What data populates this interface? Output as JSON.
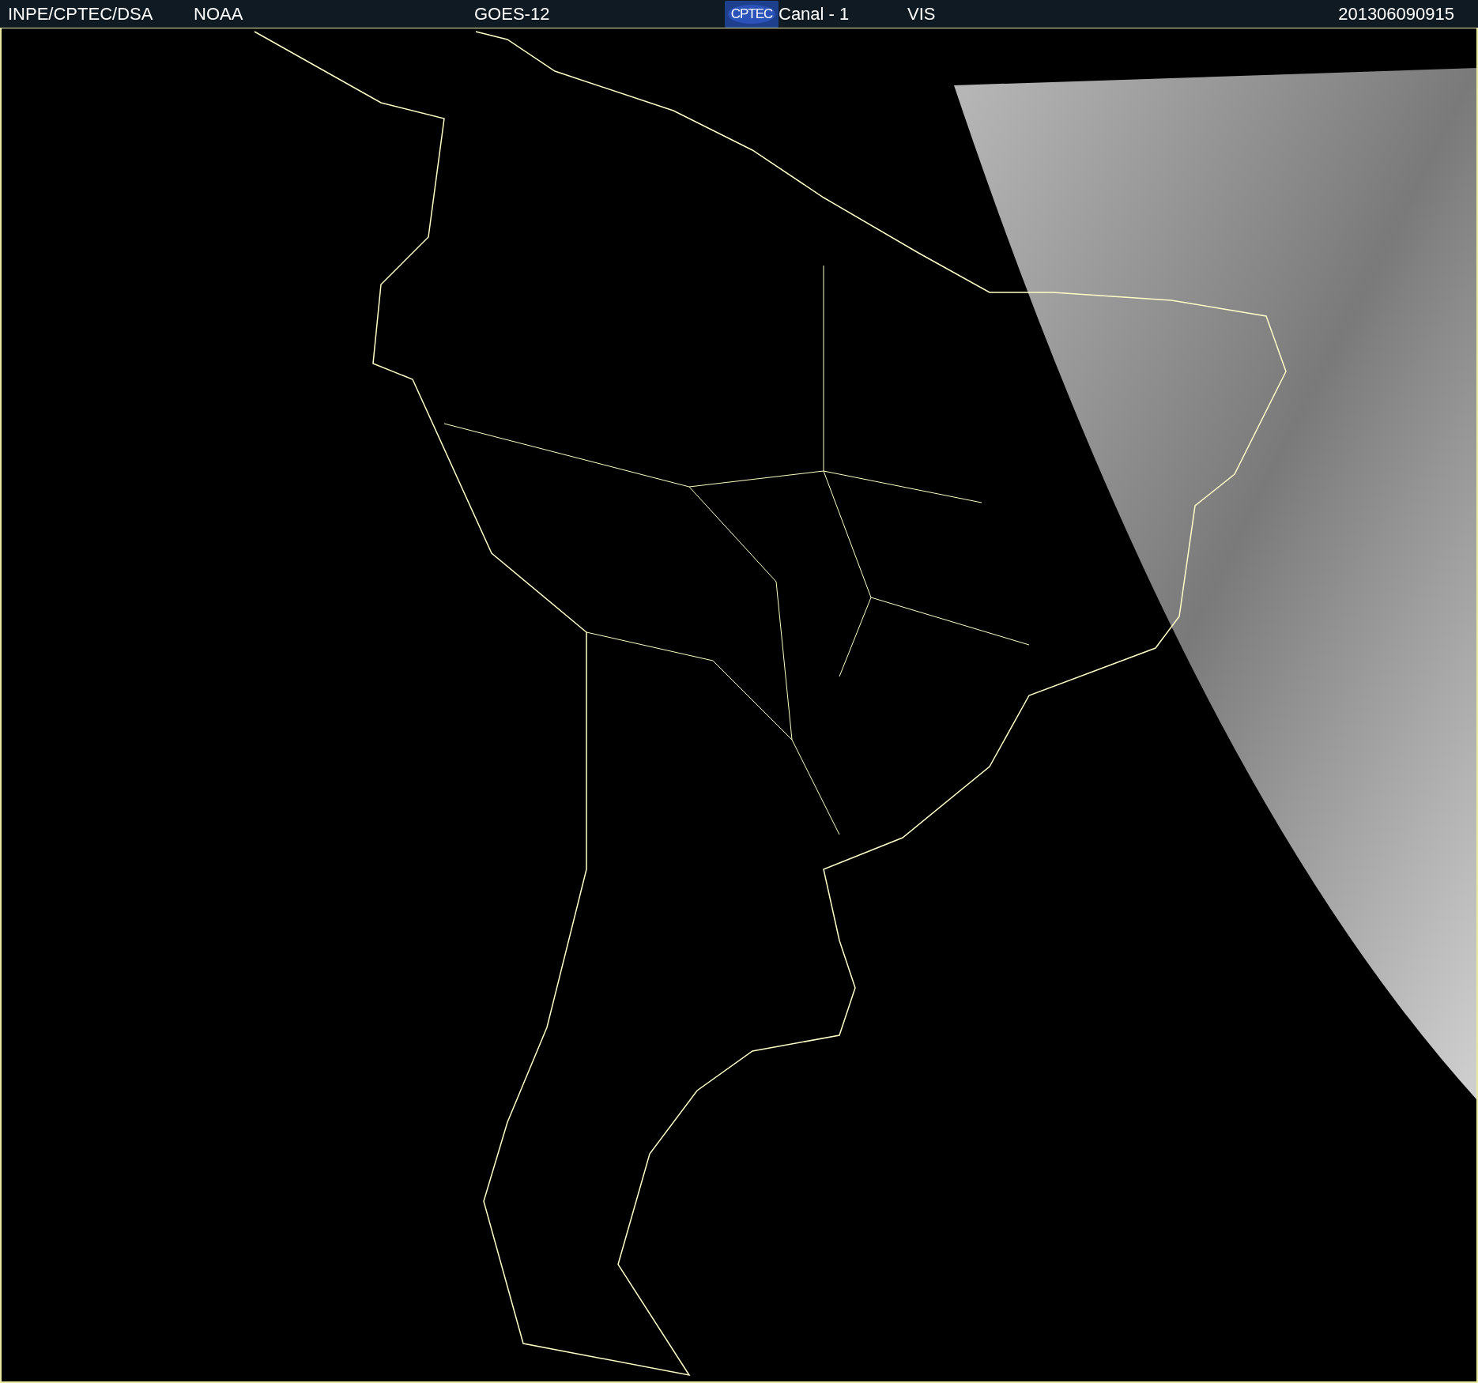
{
  "header": {
    "source": "INPE/CPTEC/DSA",
    "agency": "NOAA",
    "satellite": "GOES-12",
    "logo_text": "CPTEC",
    "channel": "Canal - 1",
    "band": "VIS",
    "timestamp": "201306090915"
  }
}
